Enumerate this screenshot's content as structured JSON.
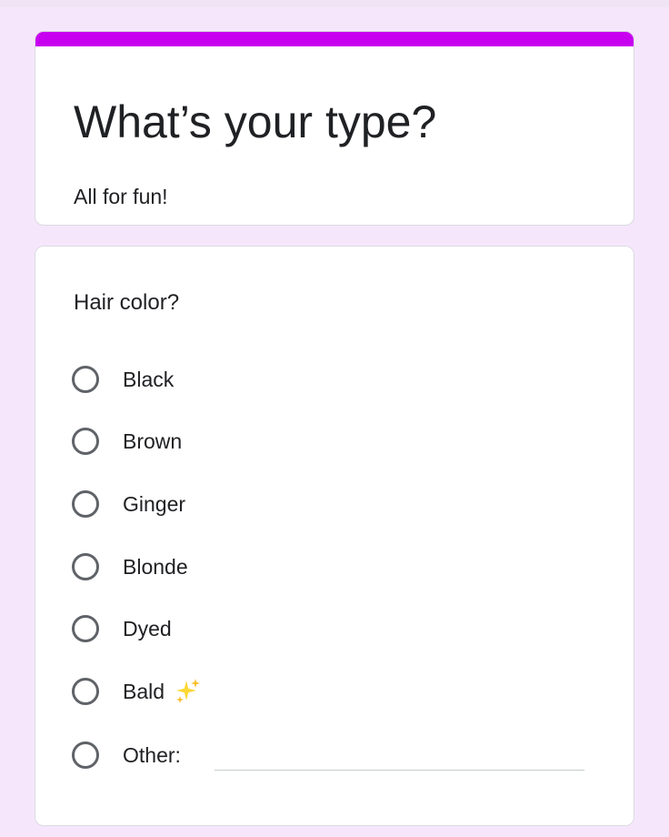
{
  "form": {
    "title": "What’s your type?",
    "description": "All for fun!",
    "accent_color": "#c800f0",
    "background_color": "#f6e6fc"
  },
  "question": {
    "title": "Hair color?",
    "options": [
      {
        "label": "Black"
      },
      {
        "label": "Brown"
      },
      {
        "label": "Ginger"
      },
      {
        "label": "Blonde"
      },
      {
        "label": "Dyed"
      },
      {
        "label": "Bald",
        "icon": "sparkles-icon"
      },
      {
        "label": "Other:"
      }
    ],
    "other_input_value": ""
  }
}
